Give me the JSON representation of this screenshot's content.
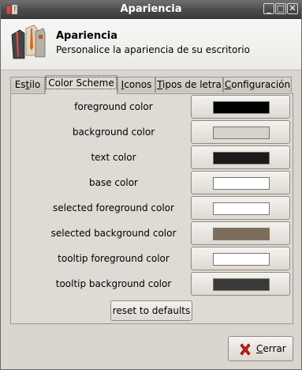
{
  "window": {
    "title": "Apariencia",
    "controls": {
      "minimize": "_",
      "maximize": "□",
      "close": "✕"
    }
  },
  "header": {
    "title": "Apariencia",
    "subtitle": "Personalice la apariencia de su escritorio",
    "icon": "appearance-shirt-tie-icon"
  },
  "tabs": [
    {
      "label": "Estilo",
      "active": false
    },
    {
      "label": "Color Scheme",
      "active": true
    },
    {
      "label": "Iconos",
      "active": false
    },
    {
      "label": "Tipos de letra",
      "active": false
    },
    {
      "label": "Configuración",
      "active": false
    }
  ],
  "color_scheme": {
    "rows": [
      {
        "label": "foreground color",
        "color": "#000000"
      },
      {
        "label": "background color",
        "color": "#d6d2cc"
      },
      {
        "label": "text color",
        "color": "#1a1a1a"
      },
      {
        "label": "base color",
        "color": "#ffffff"
      },
      {
        "label": "selected foreground color",
        "color": "#ffffff"
      },
      {
        "label": "selected background color",
        "color": "#7d6e5c"
      },
      {
        "label": "tooltip foreground color",
        "color": "#ffffff"
      },
      {
        "label": "tooltip background color",
        "color": "#3a3a3a"
      }
    ],
    "reset_label": "reset to defaults"
  },
  "footer": {
    "close_label": "Cerrar",
    "close_icon": "close-x-icon"
  }
}
